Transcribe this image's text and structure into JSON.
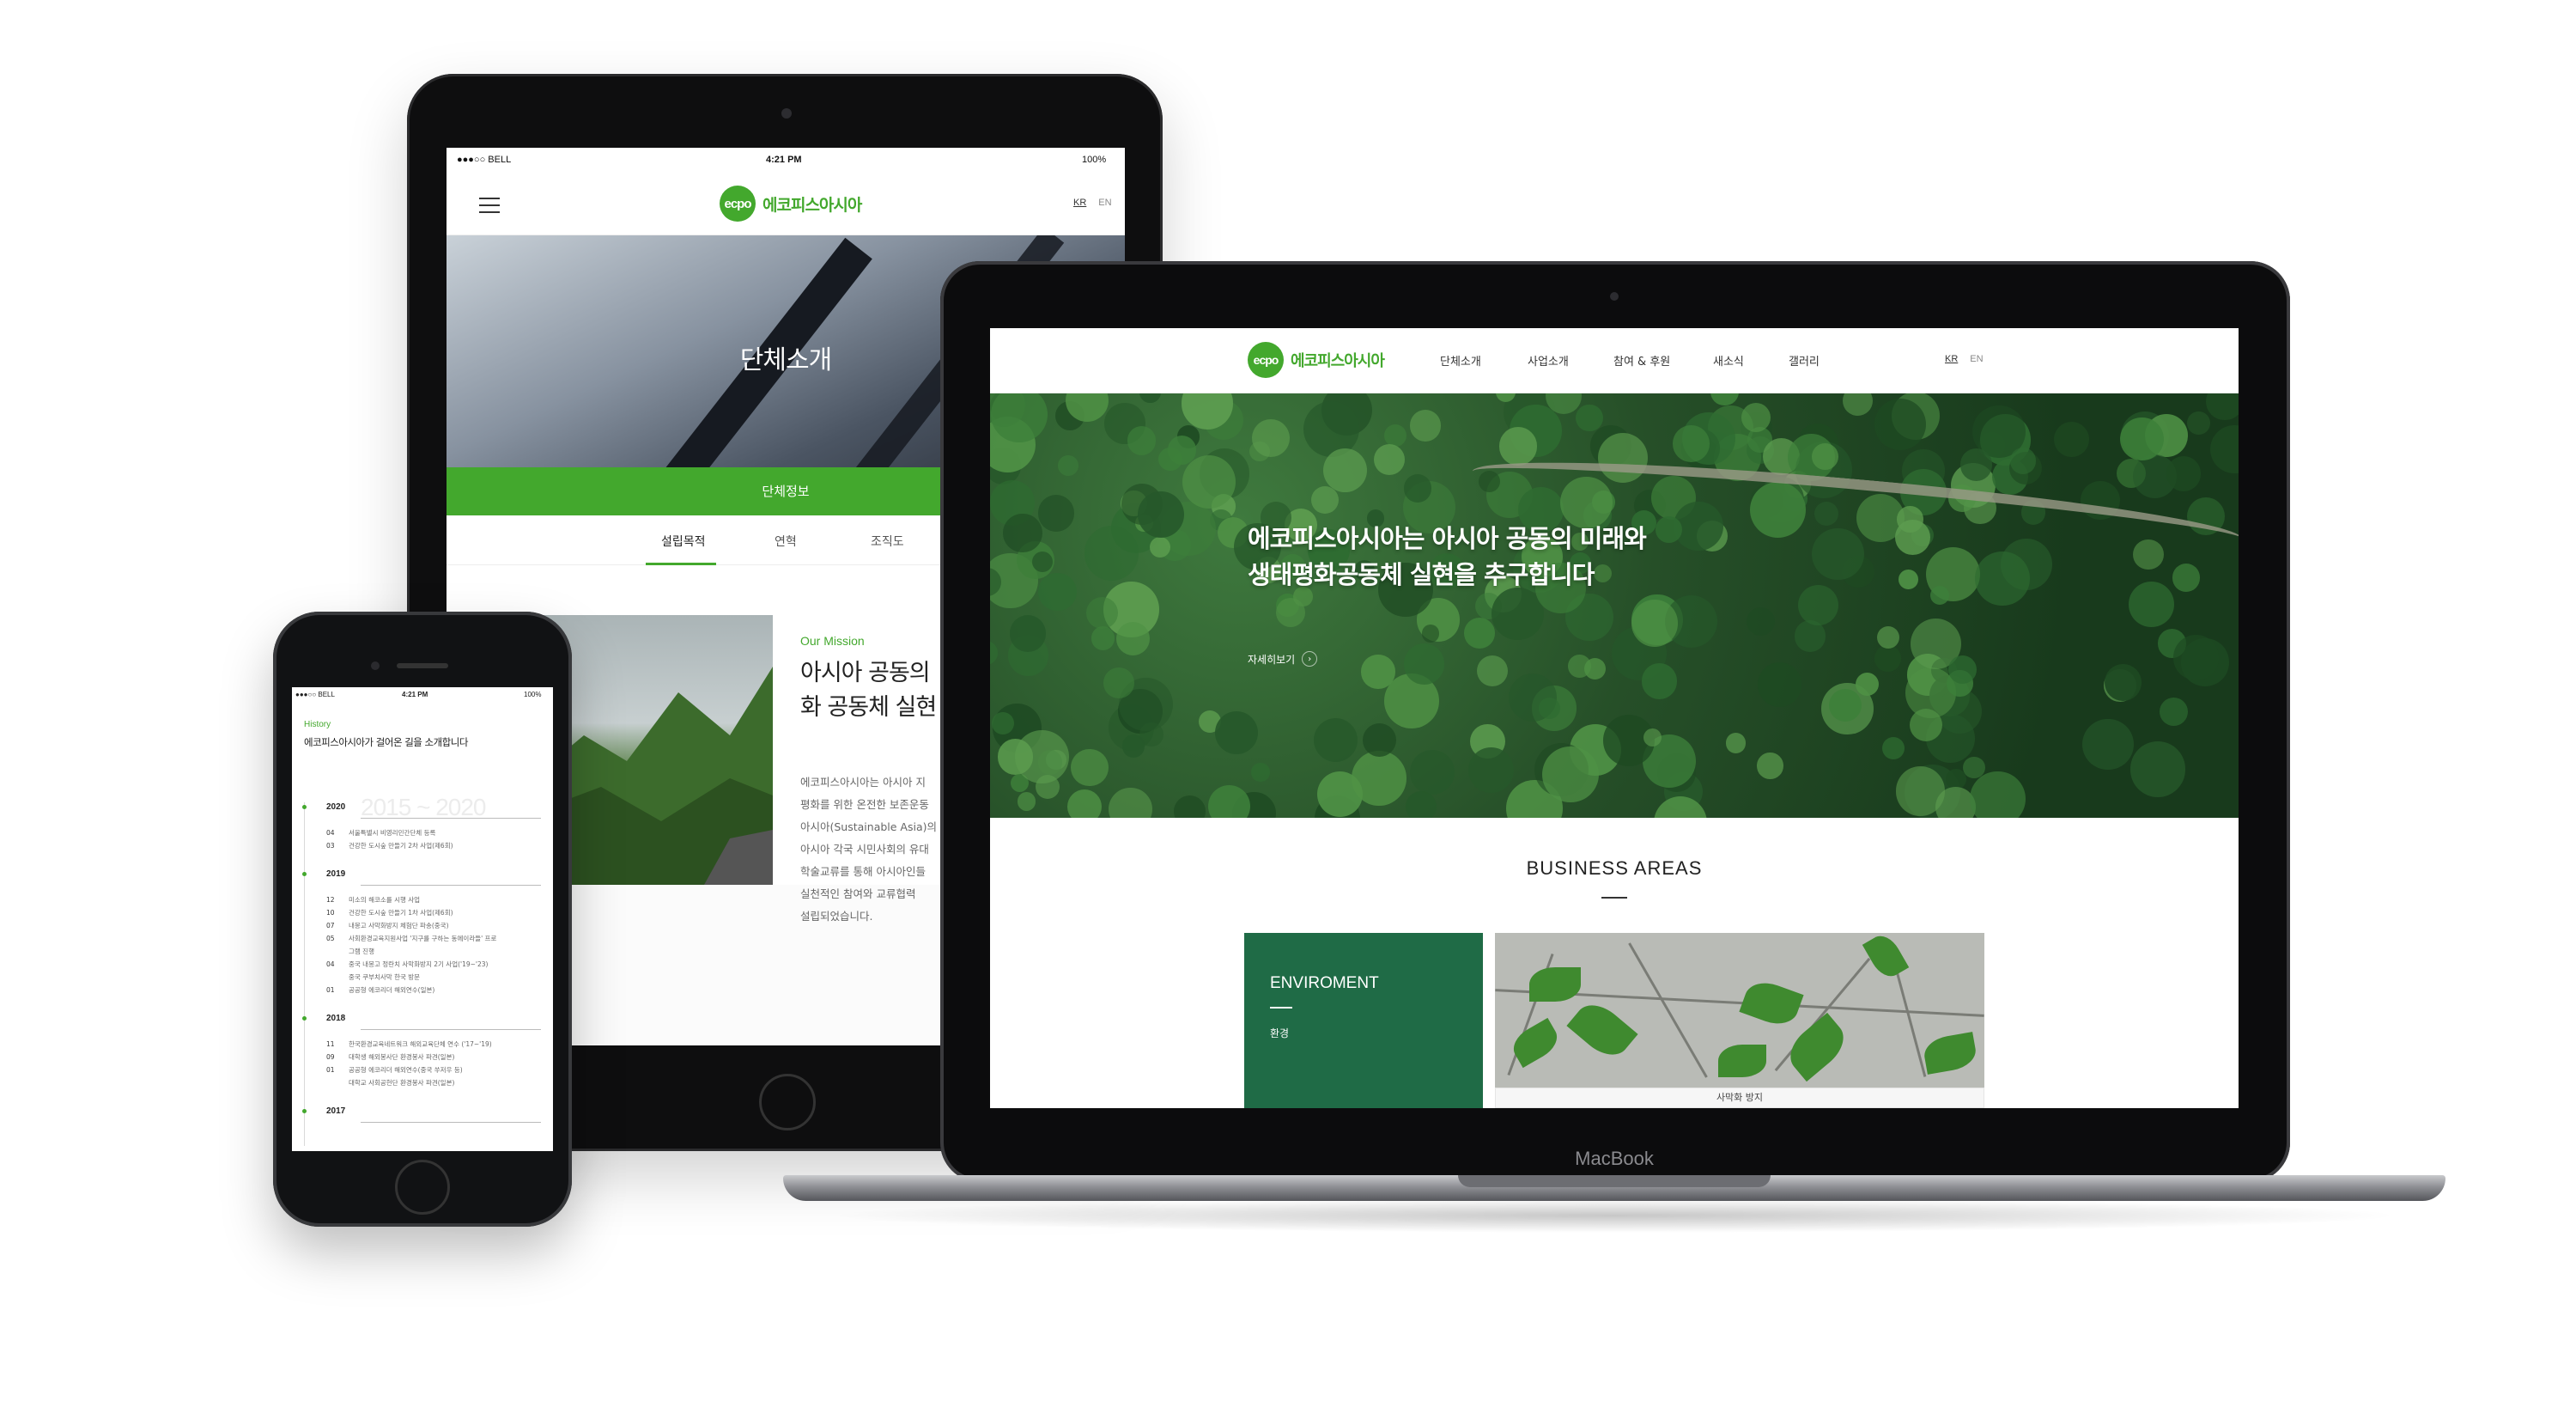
{
  "ipad": {
    "status": {
      "carrier": "●●●○○ BELL",
      "time": "4:21 PM",
      "battery": "100%"
    },
    "logo_mark": "ecpo",
    "logo_text": "에코피스아시아",
    "lang": {
      "kr": "KR",
      "en": "EN"
    },
    "hero_title": "단체소개",
    "bar_label": "단체정보",
    "tabs": [
      "설립목적",
      "연혁",
      "조직도"
    ],
    "mission_label": "Our Mission",
    "mission_title": "아시아 공동의\n화 공동체 실현",
    "mission_body": "에코피스아시아는 아시아 지\n평화를 위한 온전한 보존운동\n아시아(Sustainable Asia)의\n아시아 각국 시민사회의 유대\n학술교류를 통해 아시아인들\n실천적인 참여와 교류협력\n설립되었습니다."
  },
  "mac": {
    "logo_mark": "ecpo",
    "logo_text": "에코피스아시아",
    "nav": [
      "단체소개",
      "사업소개",
      "참여 & 후원",
      "새소식",
      "갤러리"
    ],
    "lang": {
      "kr": "KR",
      "en": "EN"
    },
    "hero_title": "에코피스아시아는 아시아 공동의 미래와\n생태평화공동체 실현을 추구합니다",
    "hero_more": "자세히보기",
    "hero_more_icon": "chevron-right-icon",
    "business_title": "BUSINESS AREAS",
    "card_title": "ENVIROMENT",
    "card_sub": "환경",
    "photo_caption": "사막화 방지",
    "brand_label": "MacBook"
  },
  "iphone": {
    "status": {
      "carrier": "●●●○○ BELL",
      "time": "4:21 PM",
      "battery": "100%"
    },
    "history_label": "History",
    "title": "에코피스아시아가 걸어온 길을 소개합니다",
    "range": "2015 ~ 2020",
    "years": [
      {
        "year": "2020",
        "events": [
          {
            "m": "04",
            "t": "서울특별시 비영리민간단체 등록"
          },
          {
            "m": "03",
            "t": "건강한 도시숲 만들기 2차 사업(제6회)"
          }
        ]
      },
      {
        "year": "2019",
        "events": [
          {
            "m": "12",
            "t": "미소의 해코소를 시행 사업"
          },
          {
            "m": "10",
            "t": "건강한 도시숲 만들기 1차 사업(제6회)"
          },
          {
            "m": "07",
            "t": "내몽고 사막화방지 체험단 파송(중국)"
          },
          {
            "m": "05",
            "t": "사회환경교육지원사업 '지구를 구하는 동에이라들' 프로"
          },
          {
            "m": "",
            "t": "그램 진행"
          },
          {
            "m": "04",
            "t": "중국 내몽고 정란치 사막화방지 2기 사업('19~'23)"
          },
          {
            "m": "",
            "t": "중국 쿠부치사막 한국 방문"
          },
          {
            "m": "01",
            "t": "공공형 에코리더 해외연수(일본)"
          }
        ]
      },
      {
        "year": "2018",
        "events": [
          {
            "m": "11",
            "t": "한국환경교육네트워크 해외교육단체 연수 ('17~'19)"
          },
          {
            "m": "09",
            "t": "대학생 해외봉사단 환경봉사 파견(일본)"
          },
          {
            "m": "01",
            "t": "공공형 에코리더 해외연수(중국 쑤저우 등)"
          },
          {
            "m": "",
            "t": "대학교 사회공헌단 환경봉사 파견(일본)"
          }
        ]
      },
      {
        "year": "2017",
        "events": []
      }
    ]
  },
  "colors": {
    "brand_green": "#43a82d",
    "card_green": "#1f6b46"
  }
}
